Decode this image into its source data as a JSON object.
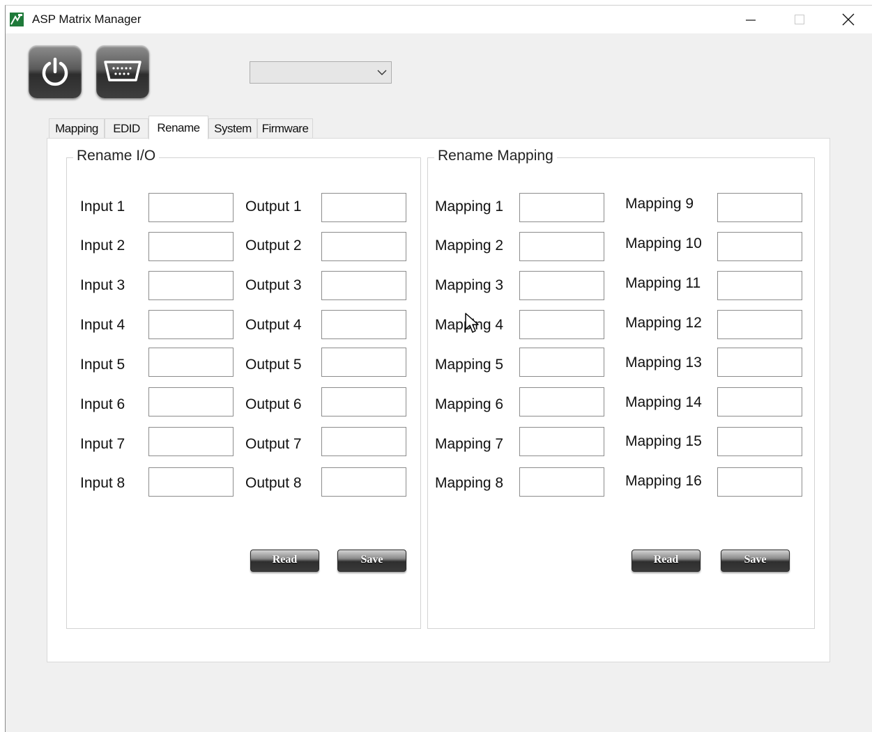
{
  "window": {
    "title": "ASP Matrix Manager",
    "minimize_icon": "minimize-icon",
    "maximize_icon": "maximize-icon",
    "close_icon": "close-icon"
  },
  "toolbar": {
    "power_icon": "power-icon",
    "serial_icon": "serial-port-icon",
    "port_select": {
      "value": ""
    }
  },
  "tabs": [
    {
      "label": "Mapping"
    },
    {
      "label": "EDID"
    },
    {
      "label": "Rename",
      "active": true
    },
    {
      "label": "System"
    },
    {
      "label": "Firmware"
    }
  ],
  "rename_io": {
    "title": "Rename I/O",
    "inputs": [
      "Input 1",
      "Input 2",
      "Input 3",
      "Input 4",
      "Input 5",
      "Input 6",
      "Input 7",
      "Input 8"
    ],
    "outputs": [
      "Output 1",
      "Output 2",
      "Output 3",
      "Output 4",
      "Output 5",
      "Output 6",
      "Output 7",
      "Output 8"
    ],
    "read_label": "Read",
    "save_label": "Save"
  },
  "rename_mapping": {
    "title": "Rename Mapping",
    "mappings_left": [
      "Mapping 1",
      "Mapping 2",
      "Mapping 3",
      "Mapping 4",
      "Mapping 5",
      "Mapping 6",
      "Mapping 7",
      "Mapping 8"
    ],
    "mappings_right": [
      "Mapping 9",
      "Mapping 10",
      "Mapping 11",
      "Mapping 12",
      "Mapping 13",
      "Mapping 14",
      "Mapping 15",
      "Mapping 16"
    ],
    "read_label": "Read",
    "save_label": "Save"
  },
  "colors": {
    "window_bg": "#f0f0f0",
    "panel_bg": "#ffffff",
    "accent_green": "#1f7a3a"
  }
}
